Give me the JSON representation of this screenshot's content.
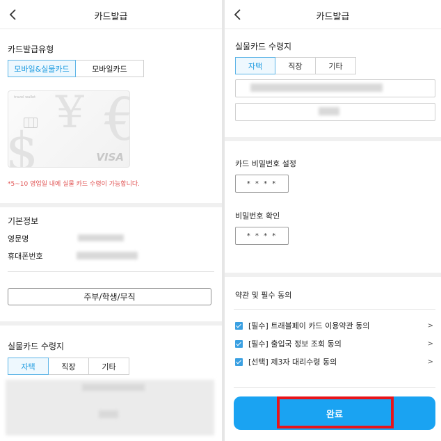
{
  "left": {
    "header_title": "카드발급",
    "card_type": {
      "label": "카드발급유형",
      "options": [
        "모바일&실물카드",
        "모바일카드"
      ],
      "selected": "모바일&실물카드"
    },
    "card_image": {
      "brand_text": "travel wallet",
      "network": "VISA"
    },
    "notice": "*5~10 영업일 내에 실물 카드 수령이 가능합니다.",
    "basic_info": {
      "label": "기본정보",
      "english_name_label": "영문명",
      "phone_label": "휴대폰번호"
    },
    "occupation_button": "주부/학생/무직",
    "delivery": {
      "label": "실물카드 수령지",
      "options": [
        "자택",
        "직장",
        "기타"
      ],
      "selected": "자택"
    }
  },
  "right": {
    "header_title": "카드발급",
    "delivery": {
      "label": "실물카드 수령지",
      "options": [
        "자택",
        "직장",
        "기타"
      ],
      "selected": "자택"
    },
    "pin_label": "카드 비밀번호 설정",
    "pin_value": "* * * *",
    "pin_confirm_label": "비밀번호 확인",
    "pin_confirm_value": "* * * *",
    "terms_label": "약관 및 필수 동의",
    "terms": [
      {
        "text": "[필수] 트래블페이 카드 이용약관 동의",
        "checked": true
      },
      {
        "text": "[필수] 출입국 정보 조회 동의",
        "checked": true
      },
      {
        "text": "[선택] 제3자 대리수령 동의",
        "checked": true
      }
    ],
    "complete_button": "완료"
  },
  "colors": {
    "accent": "#1aa3f2",
    "selected_text": "#1e9be0",
    "notice": "#e05252",
    "highlight": "#e8141a"
  }
}
